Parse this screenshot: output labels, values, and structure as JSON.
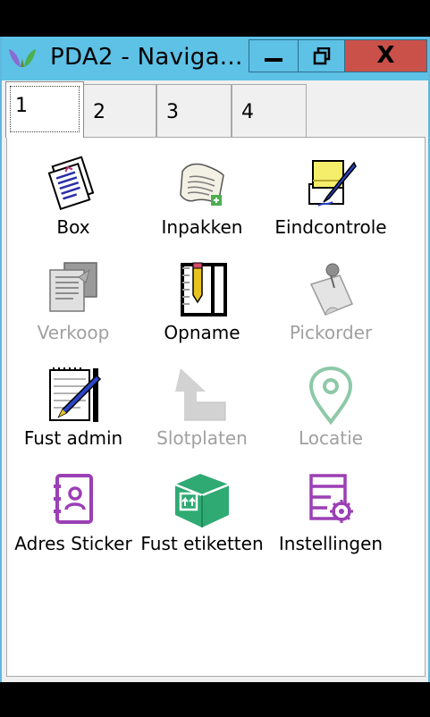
{
  "window": {
    "title": "PDA2 - Naviga...",
    "close_glyph": "X",
    "min_icon": "minimize-icon",
    "restore_icon": "restore-icon",
    "colors": {
      "titlebar": "#5ec1e6",
      "close": "#c9514a"
    }
  },
  "tabs": [
    {
      "label": "1",
      "active": true
    },
    {
      "label": "2",
      "active": false
    },
    {
      "label": "3",
      "active": false
    },
    {
      "label": "4",
      "active": false
    }
  ],
  "tiles": [
    {
      "label": "Box",
      "icon": "documents-icon",
      "enabled": true
    },
    {
      "label": "Inpakken",
      "icon": "scroll-icon",
      "enabled": true
    },
    {
      "label": "Eindcontrole",
      "icon": "notepad-pen-icon",
      "enabled": true
    },
    {
      "label": "Verkoop",
      "icon": "document-stack-icon",
      "enabled": false
    },
    {
      "label": "Opname",
      "icon": "notebook-pencil-icon",
      "enabled": true
    },
    {
      "label": "Pickorder",
      "icon": "pinned-note-icon",
      "enabled": false
    },
    {
      "label": "Fust admin",
      "icon": "notepad-fountain-pen-icon",
      "enabled": true
    },
    {
      "label": "Slotplaten",
      "icon": "arrow-turn-icon",
      "enabled": false
    },
    {
      "label": "Locatie",
      "icon": "map-pin-icon",
      "enabled": false
    },
    {
      "label": "Adres Sticker",
      "icon": "address-book-icon",
      "enabled": true
    },
    {
      "label": "Fust etiketten",
      "icon": "package-icon",
      "enabled": true
    },
    {
      "label": "Instellingen",
      "icon": "list-settings-icon",
      "enabled": true
    }
  ]
}
